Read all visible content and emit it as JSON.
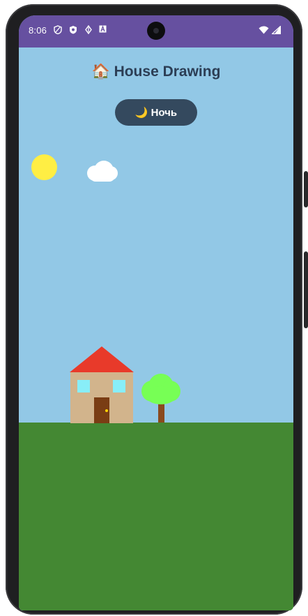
{
  "status_bar": {
    "time": "8:06",
    "icons": [
      "shield-icon",
      "vpn-icon",
      "data-saver-icon",
      "a-icon",
      "wifi-icon",
      "signal-icon"
    ]
  },
  "app": {
    "title_emoji": "🏠",
    "title": "House Drawing"
  },
  "night_button": {
    "emoji": "🌙",
    "label": "Ночь"
  },
  "scene": {
    "sky_color": "#92c8e6",
    "grass_color": "#448833",
    "sun_color": "#ffee44",
    "roof_color": "#e83a2a",
    "wall_color": "#d2b48c",
    "window_color": "#88eef8",
    "door_color": "#7a3d14",
    "tree_leaves_color": "#77ff55",
    "tree_trunk_color": "#8a4a1e"
  },
  "colors": {
    "status_bar": "#6650a0",
    "title_text": "#2c3e55",
    "button_bg": "#34495e"
  }
}
